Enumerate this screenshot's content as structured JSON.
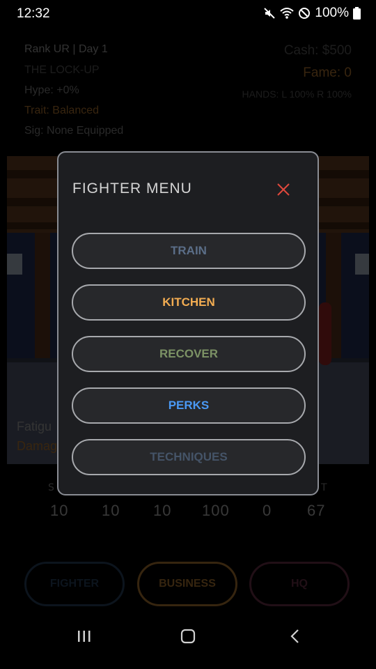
{
  "status_bar": {
    "time": "12:32",
    "battery": "100%",
    "icons": [
      "mute-icon",
      "wifi-icon",
      "do-not-disturb-icon",
      "battery-icon"
    ]
  },
  "header": {
    "rank_day": "Rank UR | Day 1",
    "location": "THE LOCK-UP",
    "hype": "Hype: +0%",
    "trait": "Trait: Balanced",
    "sig": "Sig: None Equipped",
    "cash": "Cash: $500",
    "fame": "Fame: 0",
    "hands": "HANDS: L 100%  R 100%"
  },
  "scene": {
    "fatigue_label": "Fatigu",
    "damage_label": "Damag"
  },
  "stats": {
    "header_left": "S",
    "header_right": "T",
    "values": [
      "10",
      "10",
      "10",
      "100",
      "0",
      "67"
    ]
  },
  "bottom_nav": {
    "fighter": "FIGHTER",
    "business": "BUSINESS",
    "hq": "HQ"
  },
  "modal": {
    "title": "FIGHTER MENU",
    "close": "X",
    "buttons": [
      {
        "label": "TRAIN",
        "color": "#5b6e88"
      },
      {
        "label": "KITCHEN",
        "color": "#f3ad52"
      },
      {
        "label": "RECOVER",
        "color": "#7c9265"
      },
      {
        "label": "PERKS",
        "color": "#4a99f4"
      },
      {
        "label": "TECHNIQUES",
        "color": "#455468"
      }
    ]
  },
  "colors": {
    "modal_close": "#e0483c",
    "fighter_btn": "#2e4a6c",
    "business_btn": "#c9883a",
    "hq_btn": "#7a3a55"
  }
}
